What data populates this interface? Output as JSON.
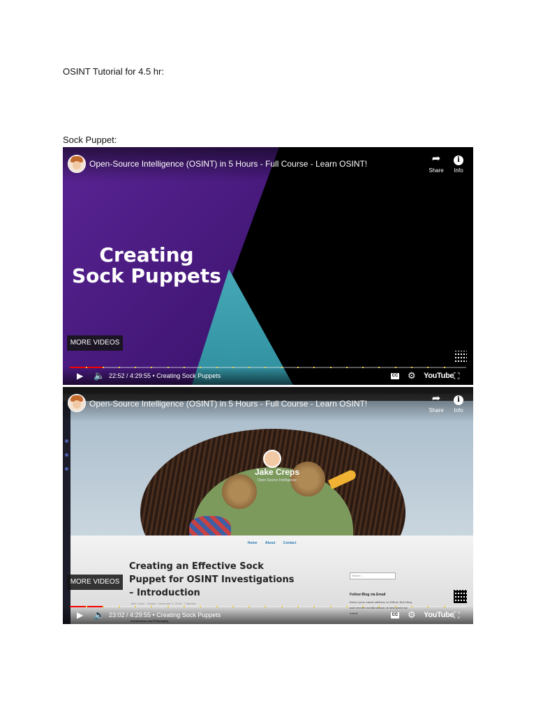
{
  "document": {
    "heading": "OSINT Tutorial for 4.5 hr:",
    "section_label": "Sock Puppet:"
  },
  "videos": [
    {
      "title": "Open-Source Intelligence (OSINT) in 5 Hours - Full Course - Learn OSINT!",
      "share_label": "Share",
      "info_label": "Info",
      "info_icon_text": "i",
      "overlay_title_line1": "Creating",
      "overlay_title_line2": "Sock Puppets",
      "more_videos_label": "MORE VIDEOS",
      "time_display": "22:52 / 4:29:55 • Creating Sock Puppets",
      "progress_fraction": 0.085,
      "cc_label": "CC",
      "youtube_label": "YouTube"
    },
    {
      "title": "Open-Source Intelligence (OSINT) in 5 Hours - Full Course - Learn OSINT!",
      "share_label": "Share",
      "info_label": "Info",
      "info_icon_text": "i",
      "more_videos_label": "MORE VIDEOS",
      "time_display": "23:02 / 4:29:55 • Creating Sock Puppets",
      "progress_fraction": 0.085,
      "cc_label": "CC",
      "youtube_label": "YouTube",
      "blog": {
        "author_name": "Jake Creps",
        "author_subtitle": "Open Source Intelligence",
        "nav": [
          "Home",
          "About",
          "Contact"
        ],
        "post_title": "Creating an Effective Sock Puppet for OSINT Investigations – Introduction",
        "post_meta": "Jake Creps · Guides · November 1, 2018 · 7 Minutes",
        "post_subheading": "Introduction and Philosophy",
        "search_placeholder": "Search …",
        "follow_heading": "Follow Blog via Email",
        "follow_description": "Enter your email address to follow this blog and receive notifications of new posts by email."
      }
    }
  ],
  "colors": {
    "progress_played": "#ff0000",
    "chapter_marker": "#f3d43b",
    "overlay_purple": "#5a2494",
    "overlay_teal": "#5fc3cf"
  },
  "icons": {
    "share": "share-arrow-icon",
    "info": "info-icon",
    "play": "play-icon",
    "volume": "volume-icon",
    "settings": "gear-icon",
    "exit_fullscreen": "exit-fullscreen-icon",
    "qr": "qr-code-icon"
  }
}
